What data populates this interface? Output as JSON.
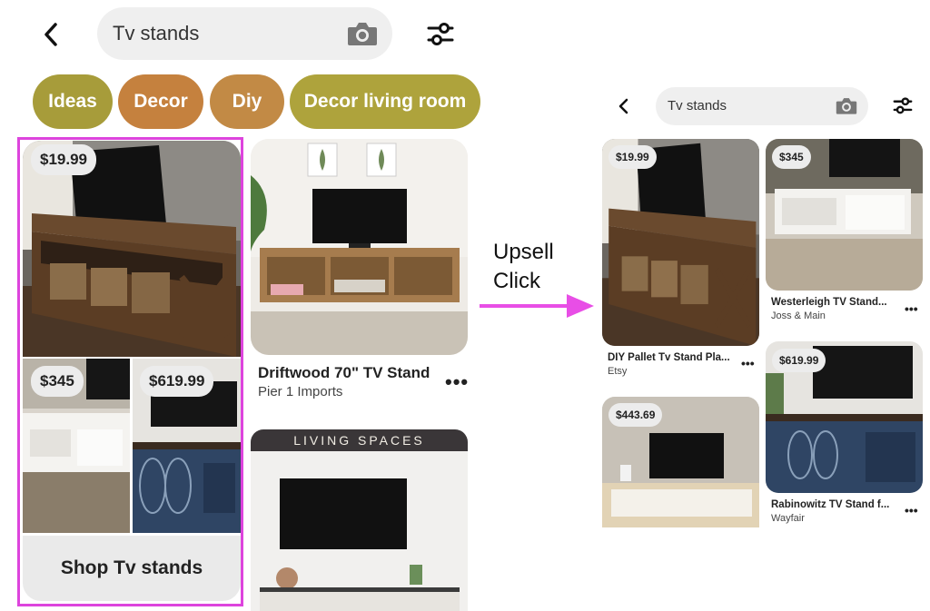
{
  "left": {
    "search": {
      "value": "Tv stands"
    },
    "chips": [
      "Ideas",
      "Decor",
      "Diy",
      "Decor living room"
    ],
    "chip_colors": [
      "#a79c3a",
      "#c5813e",
      "#c28a45",
      "#aea33c"
    ],
    "shop_card": {
      "price_main": "$19.99",
      "price_left": "$345",
      "price_right": "$619.99",
      "button": "Shop Tv stands"
    },
    "pin": {
      "title": "Driftwood 70\" TV Stand",
      "subtitle": "Pier 1 Imports"
    },
    "banner": "LIVING SPACES",
    "highlight_color": "#dd44dd"
  },
  "annotation": {
    "line1": "Upsell",
    "line2": "Click",
    "color": "#e84ee6"
  },
  "right": {
    "search": {
      "value": "Tv stands"
    },
    "pins": [
      {
        "price": "$19.99",
        "title": "DIY Pallet Tv Stand Pla...",
        "subtitle": "Etsy"
      },
      {
        "price": "$345",
        "title": "Westerleigh TV Stand...",
        "subtitle": "Joss & Main"
      },
      {
        "price": "$443.69"
      },
      {
        "price": "$619.99",
        "title": "Rabinowitz TV Stand f...",
        "subtitle": "Wayfair"
      }
    ]
  },
  "more_glyph": "•••"
}
